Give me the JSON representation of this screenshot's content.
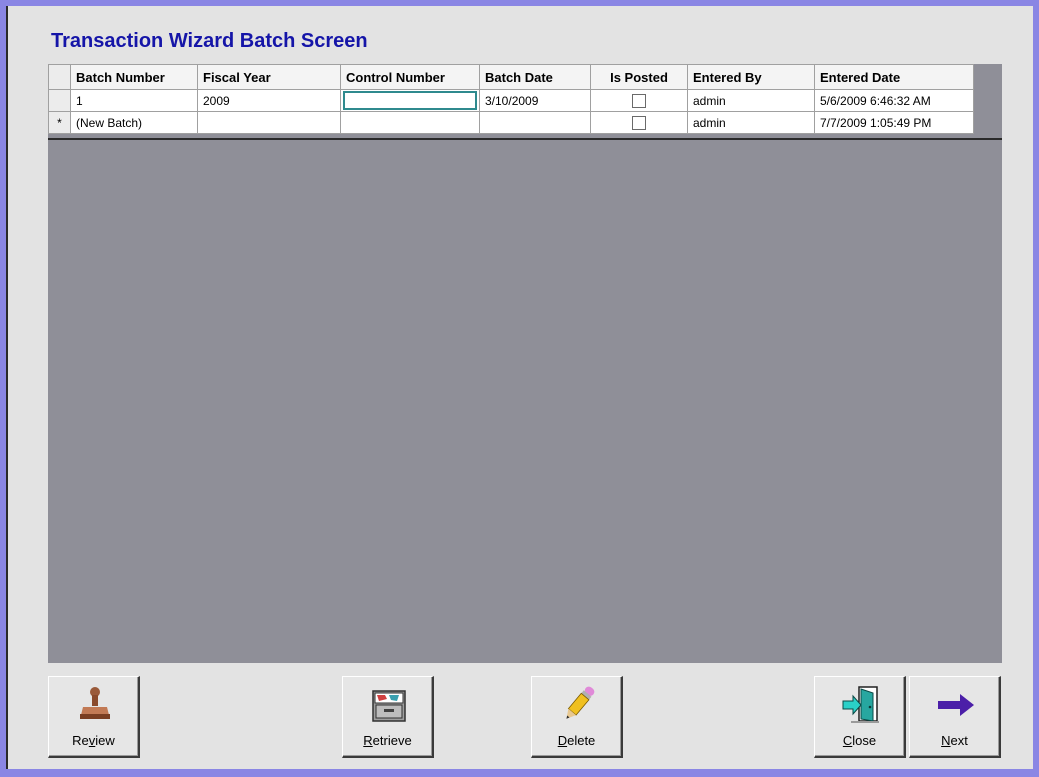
{
  "window": {
    "title": "Transaction Wizard Batch Screen"
  },
  "grid": {
    "columns": [
      "Batch Number",
      "Fiscal Year",
      "Control Number",
      "Batch Date",
      "Is Posted",
      "Entered By",
      "Entered Date"
    ],
    "rows": [
      {
        "selector": "",
        "batch_number": "1",
        "fiscal_year": "2009",
        "control_number": "",
        "batch_date": "3/10/2009",
        "is_posted": false,
        "entered_by": "admin",
        "entered_date": "5/6/2009 6:46:32 AM"
      },
      {
        "selector": "*",
        "batch_number": "(New Batch)",
        "fiscal_year": "",
        "control_number": "",
        "batch_date": "",
        "is_posted": false,
        "entered_by": "admin",
        "entered_date": "7/7/2009 1:05:49 PM"
      }
    ]
  },
  "buttons": {
    "review": {
      "pre": "Re",
      "key": "v",
      "post": "iew",
      "icon": "stamp-icon"
    },
    "retrieve": {
      "pre": "",
      "key": "R",
      "post": "etrieve",
      "icon": "file-drawer-icon"
    },
    "delete": {
      "pre": "",
      "key": "D",
      "post": "elete",
      "icon": "pencil-eraser-icon"
    },
    "close": {
      "pre": "",
      "key": "C",
      "post": "lose",
      "icon": "exit-door-icon"
    },
    "next": {
      "pre": "",
      "key": "N",
      "post": "ext",
      "icon": "arrow-right-icon"
    }
  },
  "colors": {
    "frame": "#8a86e4",
    "title": "#1515a8",
    "grid_background": "#8f8f98",
    "focus": "#2f8a8e",
    "arrow": "#4b1fa8"
  }
}
